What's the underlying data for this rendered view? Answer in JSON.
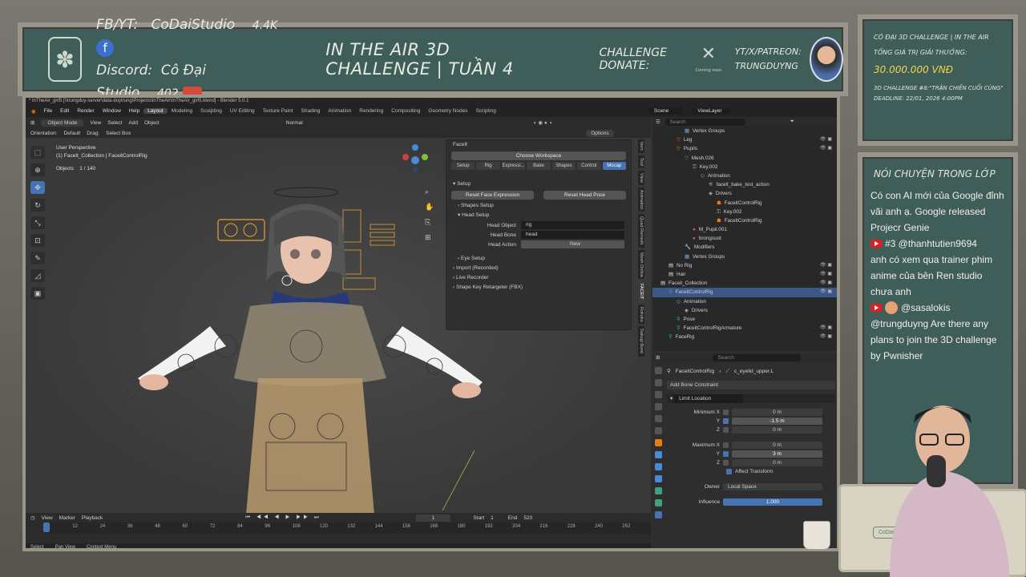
{
  "banner": {
    "fb": "FB/YT:",
    "fb_name": "CoDaiStudio",
    "fb_count": "4.4K",
    "discord": "Discord:",
    "discord_name": "Cô Đại Studio",
    "discord_count": "402",
    "title": "IN THE AIR 3D CHALLENGE | TUẦN 4",
    "donate": "CHALLENGE DONATE:",
    "donate_logo": "Coming soon",
    "streamer_line1": "YT/X/PATREON:",
    "streamer_line2": "TRUNGDUYNG"
  },
  "blender": {
    "title": "* InTheAir_girl5 [\\\\trungduy-server\\data-duytrung\\Projects\\InTheAir\\InTheAir_girl5.blend] - Blender 5.0.1",
    "menus": [
      "File",
      "Edit",
      "Render",
      "Window",
      "Help"
    ],
    "workspaces": [
      "Layout",
      "Modeling",
      "Sculpting",
      "UV Editing",
      "Texture Paint",
      "Shading",
      "Animation",
      "Rendering",
      "Compositing",
      "Geometry Nodes",
      "Scripting"
    ],
    "scene": "Scene",
    "view_layer": "ViewLayer",
    "header": {
      "mode": "Object Mode",
      "view": "View",
      "select": "Select",
      "add": "Add",
      "object": "Object",
      "shading": "Normal",
      "options": "Options"
    },
    "header2": {
      "orientation_label": "Orientation:",
      "orientation": "Default",
      "drag_label": "Drag:",
      "drag": "Select Box"
    },
    "viewport_info": {
      "line1": "User Perspective",
      "line2": "(1) FaceIt_Collection | FaceitControlRig",
      "objects_label": "Objects",
      "objects_value": "1 / 140"
    },
    "faceit": {
      "panel_title": "FaceIt",
      "choose_workspace": "Choose Workspace",
      "tabs": [
        "Setup",
        "Rig",
        "Expressi...",
        "Bake",
        "Shapes",
        "Control",
        "Mocap"
      ],
      "setup_title": "Setup",
      "reset_face": "Reset Face Expression",
      "reset_head": "Reset Head Pose",
      "shapes_setup": "Shapes Setup",
      "head_setup": "Head Setup",
      "head_object_label": "Head Object",
      "head_object": "rig",
      "head_bone_label": "Head Bone",
      "head_bone": "head",
      "head_action_label": "Head Action",
      "new": "New",
      "eye_setup": "Eye Setup",
      "import_recorded": "Import (Recorded)",
      "live_recorder": "Live Recorder",
      "retargeter": "Shape Key Retargeter (FBX)"
    },
    "side_tabs": [
      "Item",
      "Tool",
      "View",
      "Animation",
      "Quad Remesh",
      "Mesh Online",
      "FACEIT",
      "Rokoko",
      "Sakugi Bone"
    ],
    "timeline": {
      "view": "View",
      "marker": "Marker",
      "playback": "Playback",
      "frame": "1",
      "start_label": "Start",
      "start": "1",
      "end_label": "End",
      "end": "520",
      "ticks": [
        "1",
        "12",
        "24",
        "36",
        "48",
        "60",
        "72",
        "84",
        "96",
        "108",
        "120",
        "132",
        "144",
        "156",
        "168",
        "180",
        "192",
        "204",
        "216",
        "228",
        "240",
        "252"
      ]
    },
    "status": [
      "Select",
      "Pan View",
      "Context Menu"
    ],
    "outliner_search": "Search",
    "outliner": [
      {
        "indent": 4,
        "label": "Vertex Groups",
        "type": "vg"
      },
      {
        "indent": 3,
        "label": "Leg",
        "type": "mesh"
      },
      {
        "indent": 3,
        "label": "Pupils",
        "type": "mesh"
      },
      {
        "indent": 4,
        "label": "Mesh.026",
        "type": "data"
      },
      {
        "indent": 5,
        "label": "Key.002",
        "type": "key"
      },
      {
        "indent": 6,
        "label": "Animation",
        "type": "anim"
      },
      {
        "indent": 7,
        "label": "facelt_bake_test_action",
        "type": "action"
      },
      {
        "indent": 7,
        "label": "Drivers",
        "type": "drivers"
      },
      {
        "indent": 8,
        "label": "FaceitControlRig",
        "type": "obj"
      },
      {
        "indent": 8,
        "label": "Key.002",
        "type": "key"
      },
      {
        "indent": 8,
        "label": "FaceitControlRig",
        "type": "obj"
      },
      {
        "indent": 5,
        "label": "M_Pupil.001",
        "type": "mat"
      },
      {
        "indent": 5,
        "label": "brongsuot",
        "type": "mat"
      },
      {
        "indent": 4,
        "label": "Modifiers",
        "type": "mod"
      },
      {
        "indent": 4,
        "label": "Vertex Groups",
        "type": "vg"
      },
      {
        "indent": 2,
        "label": "No Rig",
        "type": "coll"
      },
      {
        "indent": 2,
        "label": "Hair",
        "type": "coll"
      },
      {
        "indent": 1,
        "label": "Faceit_Collection",
        "type": "coll"
      },
      {
        "indent": 2,
        "label": "FaceitControlRig",
        "type": "arm",
        "selected": true
      },
      {
        "indent": 3,
        "label": "Animation",
        "type": "anim"
      },
      {
        "indent": 4,
        "label": "Drivers",
        "type": "drivers"
      },
      {
        "indent": 3,
        "label": "Pose",
        "type": "pose"
      },
      {
        "indent": 3,
        "label": "FaceitControlRigArmature",
        "type": "arm"
      },
      {
        "indent": 2,
        "label": "FaceRig",
        "type": "arm"
      }
    ],
    "props": {
      "search": "Search",
      "path_obj": "FaceitControlRig",
      "path_bone": "c_eyelid_upper.L",
      "add_constraint": "Add Bone Constraint",
      "constraint_name": "Limit Location",
      "min_label": "Minimum X",
      "min_x": "0 m",
      "min_y": "-1.5 m",
      "min_z": "0 m",
      "max_label": "Maximum X",
      "max_x": "0 m",
      "max_y": "3 m",
      "max_z": "0 m",
      "affect_transform": "Affect Transform",
      "owner_label": "Owner",
      "owner": "Local Space",
      "influence_label": "Influence",
      "influence": "1.000",
      "y": "Y",
      "z": "Z"
    }
  },
  "topboard": {
    "lines": [
      "CÓ ĐẠI 3D CHALLENGE | IN THE AIR",
      "TỔNG GIÁ TRỊ GIẢI THƯỞNG:",
      "30.000.000 VNĐ",
      "3D CHALLENGE #8:\"TRẬN CHIẾN CUỐI CÙNG\"",
      "DEADLINE: 22/01, 2026 4:00PM"
    ]
  },
  "chat": {
    "title": "NÓI CHUYỆN TRONG LỚP",
    "msg1": "Có con AI mới của Google đỉnh vãi anh ạ. Google released Projecr Genie",
    "user2": "#3 @thanhtutien9694",
    "msg2": "anh có xem qua trainer phim anime của bên Ren studio chưa anh",
    "user3": "@sasalokis",
    "msg3": "@trungduyng Are there any plans to join the 3D challenge by Pwnisher"
  },
  "desk": {
    "logo": "CoDaiStudio"
  }
}
